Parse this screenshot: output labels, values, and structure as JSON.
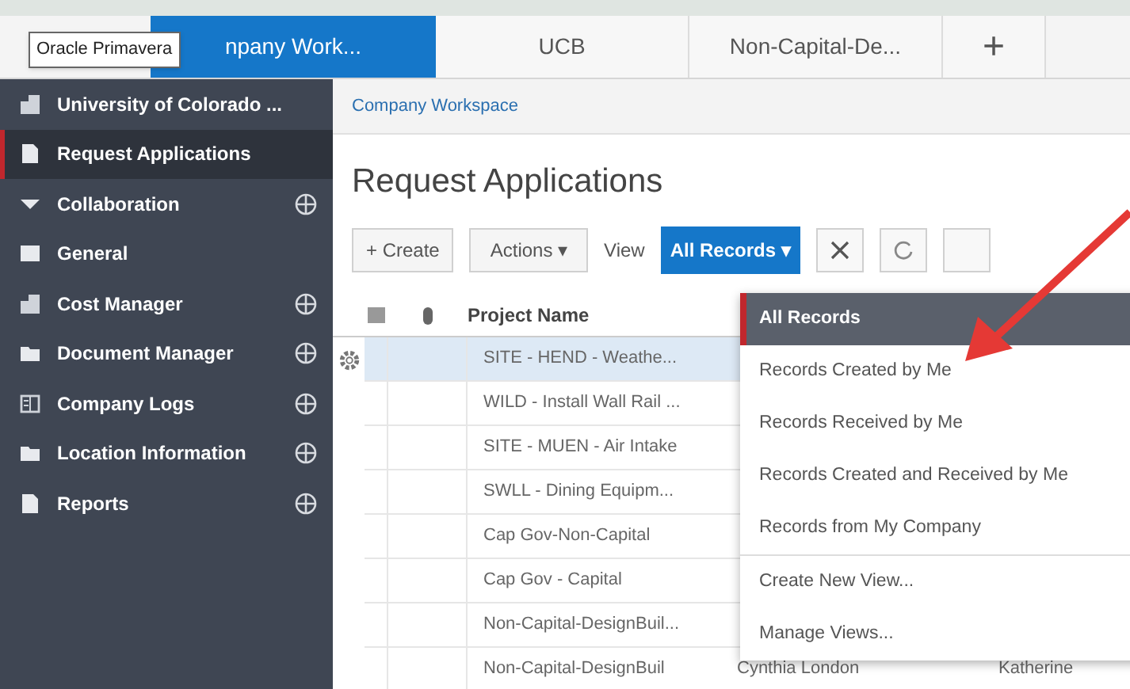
{
  "tabs": [
    {
      "label": "npany Work...",
      "selected": true
    },
    {
      "label": "UCB",
      "selected": false
    },
    {
      "label": "Non-Capital-De...",
      "selected": false
    },
    {
      "label": "+",
      "selected": false
    }
  ],
  "tooltip": "Oracle Primavera",
  "sidebar": {
    "items": [
      {
        "label": "University of Colorado ...",
        "kind": "building",
        "selected": false,
        "addable": false
      },
      {
        "label": "Request Applications",
        "kind": "doc",
        "selected": true,
        "addable": false
      },
      {
        "label": "Collaboration",
        "kind": "caret",
        "selected": false,
        "addable": true
      },
      {
        "label": "General",
        "kind": "square",
        "selected": false,
        "addable": false
      },
      {
        "label": "Cost Manager",
        "kind": "building",
        "selected": false,
        "addable": true
      },
      {
        "label": "Document Manager",
        "kind": "folder",
        "selected": false,
        "addable": true
      },
      {
        "label": "Company Logs",
        "kind": "log",
        "selected": false,
        "addable": true
      },
      {
        "label": "Location Information",
        "kind": "folder",
        "selected": false,
        "addable": true
      },
      {
        "label": "Reports",
        "kind": "doc",
        "selected": false,
        "addable": true
      }
    ]
  },
  "breadcrumb": "Company Workspace",
  "title": "Request Applications",
  "toolbar": {
    "create": "+ Create",
    "actions": "Actions ▾",
    "view_label": "View",
    "view_value": "All Records ▾"
  },
  "table": {
    "columns": [
      "Project Name"
    ],
    "rows": [
      {
        "project_name": "SITE - HEND - Weathe...",
        "selected": true
      },
      {
        "project_name": "WILD - Install Wall Rail ...",
        "selected": false
      },
      {
        "project_name": "SITE - MUEN - Air Intake",
        "selected": false
      },
      {
        "project_name": "SWLL - Dining Equipm...",
        "selected": false
      },
      {
        "project_name": "Cap Gov-Non-Capital",
        "selected": false
      },
      {
        "project_name": "Cap Gov - Capital",
        "selected": false
      },
      {
        "project_name": "Non-Capital-DesignBuil...",
        "selected": false
      },
      {
        "project_name": "Non-Capital-DesignBuil",
        "selected": false,
        "column_3": "Cynthia London",
        "column_4": "Katherine"
      }
    ]
  },
  "view_menu": {
    "items": [
      {
        "label": "All Records",
        "selected": true
      },
      {
        "label": "Records Created by Me",
        "selected": false
      },
      {
        "label": "Records Received by Me",
        "selected": false
      },
      {
        "label": "Records Created and Received by Me",
        "selected": false
      },
      {
        "label": "Records from My Company",
        "selected": false
      }
    ],
    "actions": [
      "Create New View...",
      "Manage Views..."
    ]
  }
}
